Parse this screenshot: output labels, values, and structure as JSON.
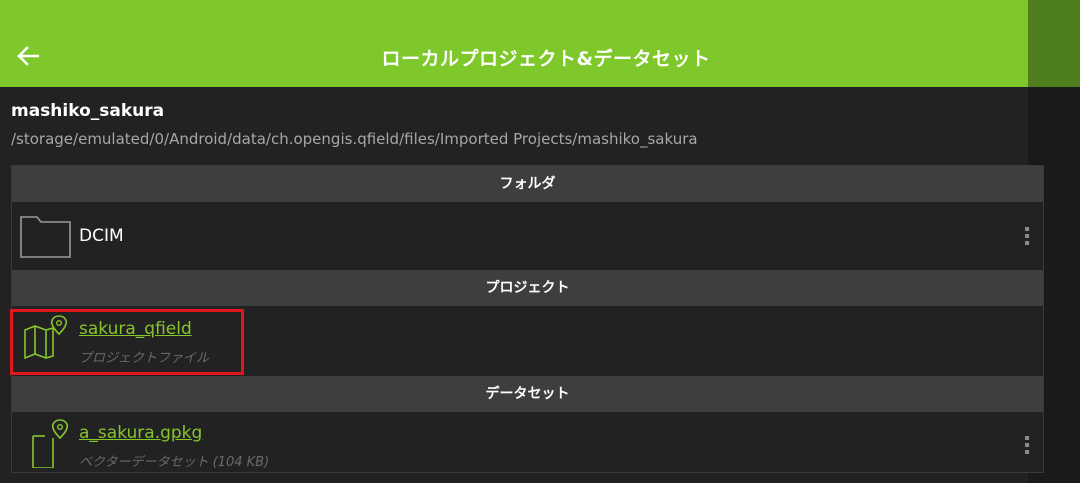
{
  "header": {
    "title": "ローカルプロジェクト&データセット",
    "accent_color": "#7ec82b",
    "back_icon": "arrow-left-icon"
  },
  "project": {
    "name": "mashiko_sakura",
    "path": "/storage/emulated/0/Android/data/ch.opengis.qfield/files/Imported Projects/mashiko_sakura"
  },
  "sections": {
    "folders": {
      "header": "フォルダ",
      "items": [
        {
          "title": "DCIM",
          "icon": "folder-icon"
        }
      ]
    },
    "projects": {
      "header": "プロジェクト",
      "items": [
        {
          "title": "sakura_qfield",
          "subtitle": "プロジェクトファイル",
          "icon": "map-pin-icon"
        }
      ]
    },
    "datasets": {
      "header": "データセット",
      "items": [
        {
          "title": "a_sakura.gpkg",
          "subtitle": "ベクターデータセット (104 KB)",
          "icon": "file-pin-icon"
        }
      ]
    }
  },
  "highlight_color": "#e0181e",
  "link_color": "#86c52c"
}
